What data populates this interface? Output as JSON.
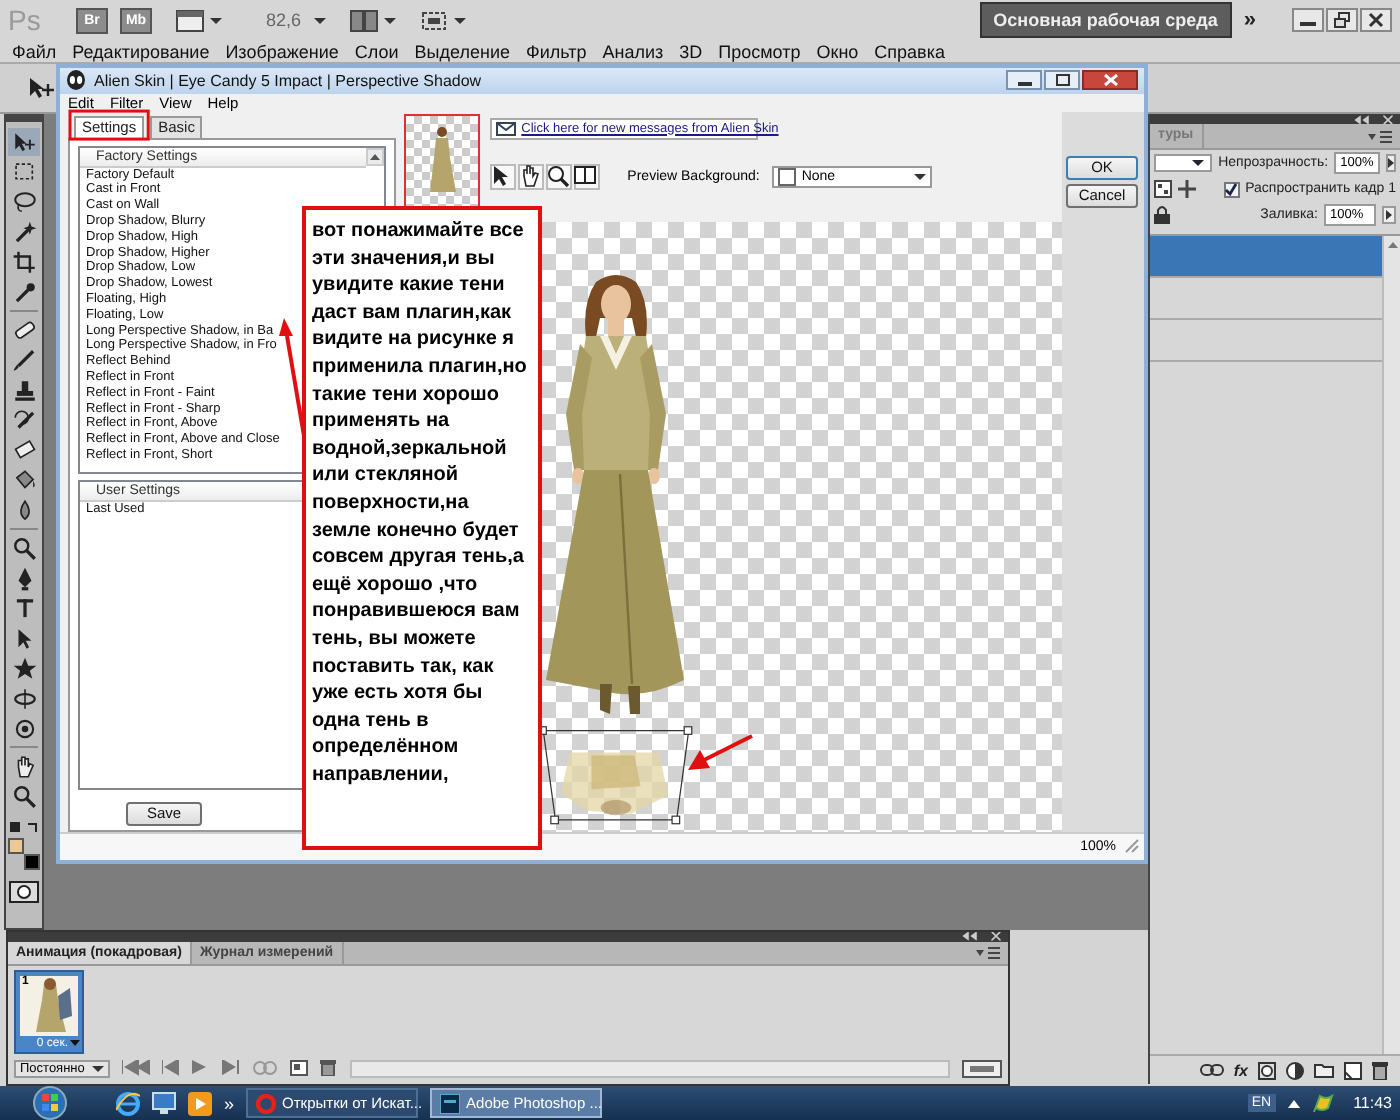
{
  "app_bar": {
    "logo": "Ps",
    "launchers": [
      "Br",
      "Mb"
    ],
    "zoom": "82,6",
    "workspace": "Основная рабочая среда",
    "overflow": "»"
  },
  "menu": [
    "Файл",
    "Редактирование",
    "Изображение",
    "Слои",
    "Выделение",
    "Фильтр",
    "Анализ",
    "3D",
    "Просмотр",
    "Окно",
    "Справка"
  ],
  "dialog": {
    "title": "Alien Skin | Eye Candy 5 Impact | Perspective Shadow",
    "menu": [
      "Edit",
      "Filter",
      "View",
      "Help"
    ],
    "tabs": [
      {
        "label": "Settings",
        "selected": true
      },
      {
        "label": "Basic",
        "selected": false
      }
    ],
    "factory_settings": {
      "header": "Factory Settings",
      "items": [
        "Factory Default",
        "Cast in Front",
        "Cast on Wall",
        "Drop Shadow, Blurry",
        "Drop Shadow, High",
        "Drop Shadow, Higher",
        "Drop Shadow, Low",
        "Drop Shadow, Lowest",
        "Floating, High",
        "Floating, Low",
        "Long Perspective Shadow, in Ba",
        "Long Perspective Shadow, in Fro",
        "Reflect Behind",
        "Reflect in Front",
        "Reflect in Front - Faint",
        "Reflect in Front - Sharp",
        "Reflect in Front, Above",
        "Reflect in Front, Above and Close",
        "Reflect in Front, Short"
      ]
    },
    "user_settings": {
      "header": "User Settings",
      "items": [
        "Last Used"
      ]
    },
    "save_button": "Save",
    "message_link": "Click here for new messages from Alien Skin",
    "preview_background": {
      "label": "Preview Background:",
      "value": "None"
    },
    "buttons": [
      "OK",
      "Cancel"
    ],
    "zoom": "100%"
  },
  "note": "вот понажимайте все эти значения,и вы увидите какие тени даст вам плагин,как видите на рисунке я применила плагин,но такие тени хорошо применять на водной,зеркальной или стекляной поверхности,на земле конечно будет совсем другая тень,а ещё хорошо ,что понравившеюся вам тень, вы можете поставить так, как уже есть хотя бы одна тень в определённом направлении,",
  "layers_panel": {
    "tab": "туры",
    "opacity_label": "Непрозрачность:",
    "opacity": "100%",
    "propagate": {
      "label": "Распространить кадр 1",
      "checked": true
    },
    "fill_label": "Заливка:",
    "fill": "100%",
    "fx": "fx",
    "layers": [
      {
        "selected": true
      },
      {
        "selected": false
      },
      {
        "selected": false
      }
    ]
  },
  "animation_panel": {
    "tabs": [
      {
        "label": "Анимация (покадровая)",
        "selected": true
      },
      {
        "label": "Журнал измерений",
        "selected": false
      }
    ],
    "frames": [
      {
        "number": "1",
        "delay": "0 сек.",
        "selected": true
      }
    ],
    "loop": "Постоянно"
  },
  "taskbar": {
    "overflow": "»",
    "buttons": [
      {
        "label": "Открытки от Искат...",
        "kind": "browser",
        "selected": false
      },
      {
        "label": "Adobe Photoshop ...",
        "kind": "photoshop",
        "selected": true
      }
    ],
    "language": "EN",
    "time": "11:43"
  }
}
